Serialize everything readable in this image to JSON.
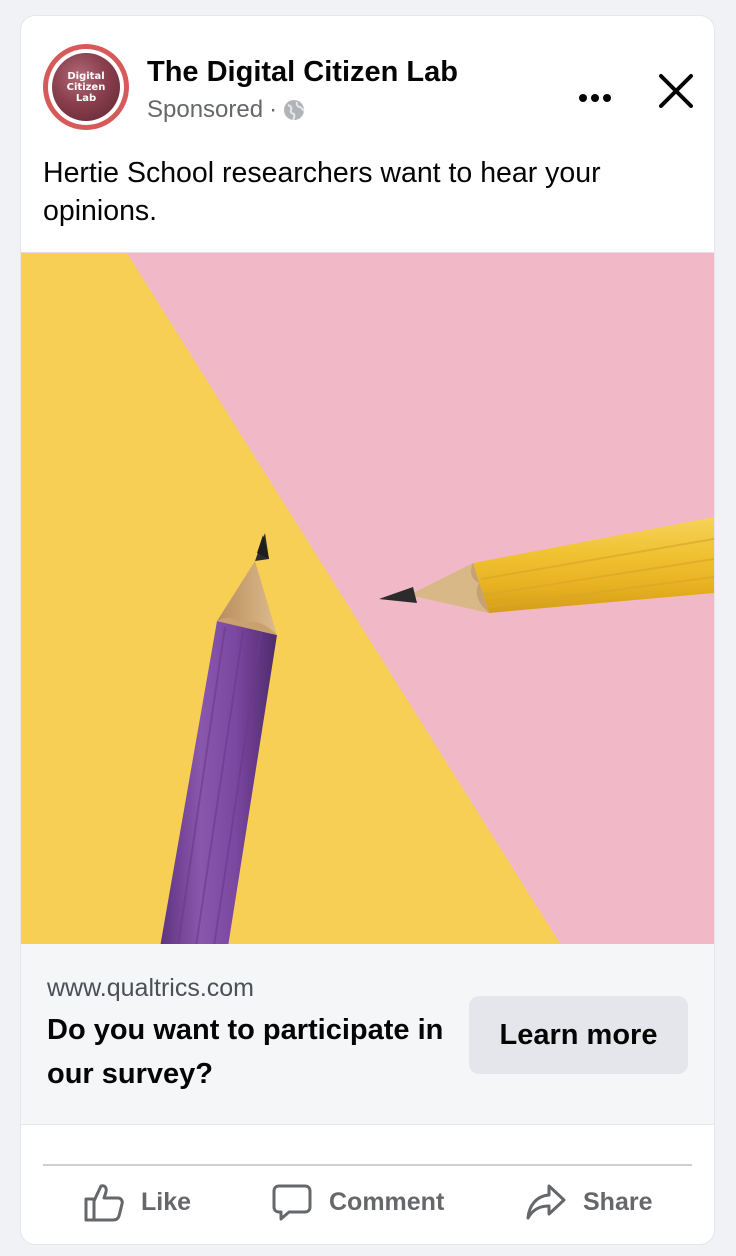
{
  "post": {
    "page_name": "The Digital Citizen Lab",
    "sponsored_label": "Sponsored",
    "separator": "·",
    "body_text": "Hertie School researchers want to hear your opinions.",
    "avatar": {
      "line1": "Digital",
      "line2": "Citizen",
      "line3": "Lab"
    }
  },
  "header_icons": {
    "privacy": "globe-icon",
    "more": "more-options-icon",
    "close": "close-icon"
  },
  "link_preview": {
    "domain": "www.qualtrics.com",
    "headline": "Do you want to participate in our survey?",
    "cta_label": "Learn more"
  },
  "actions": {
    "like_label": "Like",
    "comment_label": "Comment",
    "share_label": "Share"
  },
  "colors": {
    "image_pink": "#f1b8c8",
    "image_yellow": "#f7cf55",
    "pencil_purple": "#7e4a9e",
    "pencil_yellow": "#f2c63b",
    "avatar_ring": "#d65a5a",
    "secondary_text": "#65676b",
    "button_gray": "#e4e6eb"
  }
}
